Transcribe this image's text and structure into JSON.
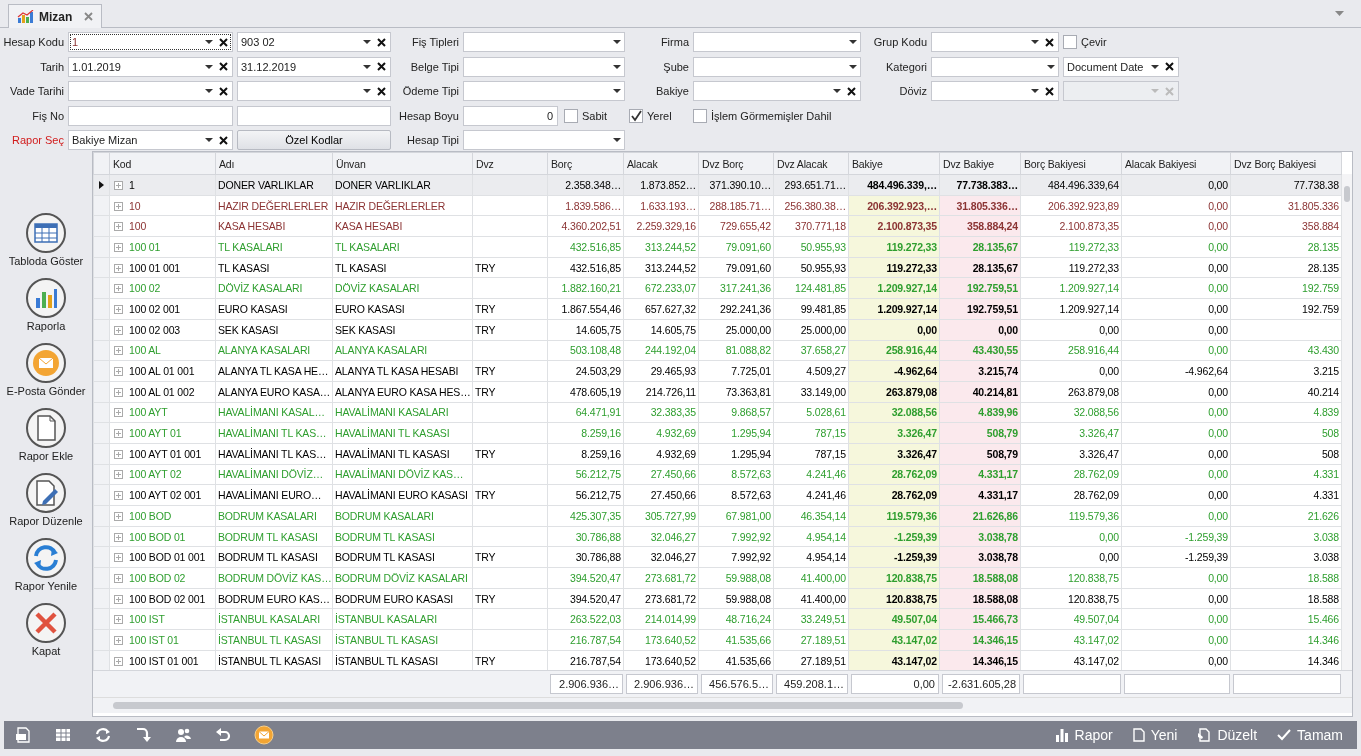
{
  "tab": {
    "title": "Mizan",
    "selected": true
  },
  "filters": [
    [
      {
        "kind": "label",
        "text": "Hesap Kodu"
      },
      {
        "kind": "combo",
        "value": "1",
        "clear": true,
        "focused": true
      },
      {
        "kind": "combo",
        "value": "903 02",
        "clear": true
      },
      {
        "kind": "label",
        "text": "Fiş Tipleri"
      },
      {
        "kind": "combo",
        "clear": false
      },
      {
        "kind": "label",
        "text": "Firma"
      },
      {
        "kind": "combo",
        "clear": false
      },
      {
        "kind": "label",
        "text": "Grup Kodu"
      },
      {
        "kind": "combo",
        "clear": true
      },
      {
        "kind": "checkbox",
        "text": "Çevir",
        "checked": false
      }
    ],
    [
      {
        "kind": "label",
        "text": "Tarih"
      },
      {
        "kind": "combo",
        "value": "1.01.2019",
        "clear": true
      },
      {
        "kind": "combo",
        "value": "31.12.2019",
        "clear": true
      },
      {
        "kind": "label",
        "text": "Belge Tipi"
      },
      {
        "kind": "combo",
        "clear": false
      },
      {
        "kind": "label",
        "text": "Şube"
      },
      {
        "kind": "combo",
        "clear": false
      },
      {
        "kind": "label",
        "text": "Kategori"
      },
      {
        "kind": "combo",
        "clear": false
      },
      {
        "kind": "combo",
        "value": "Document Date",
        "clear": true
      }
    ],
    [
      {
        "kind": "label",
        "text": "Vade Tarihi"
      },
      {
        "kind": "combo",
        "clear": true
      },
      {
        "kind": "combo",
        "clear": true
      },
      {
        "kind": "label",
        "text": "Ödeme Tipi"
      },
      {
        "kind": "combo",
        "clear": false
      },
      {
        "kind": "label",
        "text": "Bakiye"
      },
      {
        "kind": "combo",
        "clear": true
      },
      {
        "kind": "label",
        "text": "Döviz"
      },
      {
        "kind": "combo",
        "clear": true
      },
      {
        "kind": "combo",
        "clear": true,
        "disabled": true
      }
    ],
    [
      {
        "kind": "label",
        "text": "Fiş No"
      },
      {
        "kind": "text"
      },
      {
        "kind": "text"
      },
      {
        "kind": "label",
        "text": "Hesap Boyu"
      },
      {
        "kind": "number",
        "value": "0",
        "checkbox": {
          "text": "Sabit",
          "checked": false
        }
      },
      {
        "kind": "checkbox",
        "text": "Yerel",
        "checked": true
      },
      {
        "kind": "checkbox",
        "text": "İşlem Görmemişler Dahil",
        "checked": false
      }
    ],
    [
      {
        "kind": "label",
        "text": "Rapor Seç",
        "emphasis": true
      },
      {
        "kind": "combo",
        "value": "Bakiye Mizan",
        "clear": true
      },
      {
        "kind": "button",
        "text": "Özel Kodlar"
      },
      {
        "kind": "label",
        "text": "Hesap Tipi"
      },
      {
        "kind": "combo",
        "clear": false
      }
    ]
  ],
  "sidebar": [
    "Tabloda Göster",
    "Raporla",
    "E-Posta Gönder",
    "Rapor Ekle",
    "Rapor Düzenle",
    "Rapor Yenile",
    "Kapat"
  ],
  "table": {
    "columns": [
      "Kod",
      "Adı",
      "Ünvan",
      "Dvz",
      "Borç",
      "Alacak",
      "Dvz Borç",
      "Dvz Alacak",
      "Bakiye",
      "Dvz Bakiye",
      "Borç Bakiyesi",
      "Alacak Bakiyesi",
      "Dvz Borç Bakiyesi"
    ],
    "rows": [
      {
        "selected": true,
        "color": "#000000",
        "cells": [
          "1",
          "DONER VARLIKLAR",
          "DONER VARLIKLAR",
          null,
          "2.358.348…",
          "1.873.852…",
          "371.390.10…",
          "293.651.71…",
          "484.496.339,…",
          "77.738.383…",
          "484.496.339,64",
          "0,00",
          "77.738.38"
        ]
      },
      {
        "selected": false,
        "color": "#8b3333",
        "cells": [
          "10",
          "HAZIR DEĞERLERLER",
          "HAZIR DEĞERLERLER",
          null,
          "1.839.586…",
          "1.633.193…",
          "288.185.71…",
          "256.380.38…",
          "206.392.923,…",
          "31.805.336…",
          "206.392.923,89",
          "0,00",
          "31.805.336"
        ]
      },
      {
        "selected": false,
        "color": "#8b3333",
        "cells": [
          "100",
          "KASA HESABI",
          "KASA HESABI",
          null,
          "4.360.202,51",
          "2.259.329,16",
          "729.655,42",
          "370.771,18",
          "2.100.873,35",
          "358.884,24",
          "2.100.873,35",
          "0,00",
          "358.884"
        ]
      },
      {
        "selected": false,
        "color": "#2e9e2e",
        "cells": [
          "100 01",
          "TL KASALARI",
          "TL KASALARI",
          null,
          "432.516,85",
          "313.244,52",
          "79.091,60",
          "50.955,93",
          "119.272,33",
          "28.135,67",
          "119.272,33",
          "0,00",
          "28.135"
        ]
      },
      {
        "selected": false,
        "color": "#000000",
        "cells": [
          "100 01 001",
          "TL KASASI",
          "TL KASASI",
          "TRY",
          "432.516,85",
          "313.244,52",
          "79.091,60",
          "50.955,93",
          "119.272,33",
          "28.135,67",
          "119.272,33",
          "0,00",
          "28.135"
        ]
      },
      {
        "selected": false,
        "color": "#2e9e2e",
        "cells": [
          "100 02",
          "DÖVİZ KASALARI",
          "DÖVİZ KASALARI",
          null,
          "1.882.160,21",
          "672.233,07",
          "317.241,36",
          "124.481,85",
          "1.209.927,14",
          "192.759,51",
          "1.209.927,14",
          "0,00",
          "192.759"
        ]
      },
      {
        "selected": false,
        "color": "#000000",
        "cells": [
          "100 02 001",
          "EURO KASASI",
          "EURO KASASI",
          "TRY",
          "1.867.554,46",
          "657.627,32",
          "292.241,36",
          "99.481,85",
          "1.209.927,14",
          "192.759,51",
          "1.209.927,14",
          "0,00",
          "192.759"
        ]
      },
      {
        "selected": false,
        "color": "#000000",
        "cells": [
          "100 02 003",
          "SEK KASASI",
          "SEK KASASI",
          "TRY",
          "14.605,75",
          "14.605,75",
          "25.000,00",
          "25.000,00",
          "0,00",
          "0,00",
          "0,00",
          "0,00",
          null
        ]
      },
      {
        "selected": false,
        "color": "#2e9e2e",
        "cells": [
          "100 AL",
          "ALANYA KASALARI",
          "ALANYA KASALARI",
          null,
          "503.108,48",
          "244.192,04",
          "81.088,82",
          "37.658,27",
          "258.916,44",
          "43.430,55",
          "258.916,44",
          "0,00",
          "43.430"
        ]
      },
      {
        "selected": false,
        "color": "#000000",
        "cells": [
          "100 AL 01 001",
          "ALANYA TL KASA HE…",
          "ALANYA TL KASA HESABI",
          "TRY",
          "24.503,29",
          "29.465,93",
          "7.725,01",
          "4.509,27",
          "-4.962,64",
          "3.215,74",
          "0,00",
          "-4.962,64",
          "3.215"
        ]
      },
      {
        "selected": false,
        "color": "#000000",
        "cells": [
          "100 AL 01 002",
          "ALANYA EURO KASA…",
          "ALANYA EURO KASA HES…",
          "TRY",
          "478.605,19",
          "214.726,11",
          "73.363,81",
          "33.149,00",
          "263.879,08",
          "40.214,81",
          "263.879,08",
          "0,00",
          "40.214"
        ]
      },
      {
        "selected": false,
        "color": "#2e9e2e",
        "cells": [
          "100 AYT",
          "HAVALİMANI KASAL…",
          "HAVALİMANI KASALARI",
          null,
          "64.471,91",
          "32.383,35",
          "9.868,57",
          "5.028,61",
          "32.088,56",
          "4.839,96",
          "32.088,56",
          "0,00",
          "4.839"
        ]
      },
      {
        "selected": false,
        "color": "#2e9e2e",
        "cells": [
          "100 AYT 01",
          "HAVALİMANI TL KAS…",
          "HAVALİMANI TL KASASI",
          null,
          "8.259,16",
          "4.932,69",
          "1.295,94",
          "787,15",
          "3.326,47",
          "508,79",
          "3.326,47",
          "0,00",
          "508"
        ]
      },
      {
        "selected": false,
        "color": "#000000",
        "cells": [
          "100 AYT 01 001",
          "HAVALİMANI TL KAS…",
          "HAVALİMANI TL KASASI",
          "TRY",
          "8.259,16",
          "4.932,69",
          "1.295,94",
          "787,15",
          "3.326,47",
          "508,79",
          "3.326,47",
          "0,00",
          "508"
        ]
      },
      {
        "selected": false,
        "color": "#2e9e2e",
        "cells": [
          "100 AYT 02",
          "HAVALİMANI DÖVİZ…",
          "HAVALİMANI DÖVİZ KAS…",
          null,
          "56.212,75",
          "27.450,66",
          "8.572,63",
          "4.241,46",
          "28.762,09",
          "4.331,17",
          "28.762,09",
          "0,00",
          "4.331"
        ]
      },
      {
        "selected": false,
        "color": "#000000",
        "cells": [
          "100 AYT 02 001",
          "HAVALİMANI EURO…",
          "HAVALİMANI EURO KASASI",
          "TRY",
          "56.212,75",
          "27.450,66",
          "8.572,63",
          "4.241,46",
          "28.762,09",
          "4.331,17",
          "28.762,09",
          "0,00",
          "4.331"
        ]
      },
      {
        "selected": false,
        "color": "#2e9e2e",
        "cells": [
          "100 BOD",
          "BODRUM KASALARI",
          "BODRUM KASALARI",
          null,
          "425.307,35",
          "305.727,99",
          "67.981,00",
          "46.354,14",
          "119.579,36",
          "21.626,86",
          "119.579,36",
          "0,00",
          "21.626"
        ]
      },
      {
        "selected": false,
        "color": "#2e9e2e",
        "cells": [
          "100 BOD 01",
          "BODRUM TL KASASI",
          "BODRUM TL KASASI",
          null,
          "30.786,88",
          "32.046,27",
          "7.992,92",
          "4.954,14",
          "-1.259,39",
          "3.038,78",
          "0,00",
          "-1.259,39",
          "3.038"
        ]
      },
      {
        "selected": false,
        "color": "#000000",
        "cells": [
          "100 BOD 01 001",
          "BODRUM TL KASASI",
          "BODRUM TL KASASI",
          "TRY",
          "30.786,88",
          "32.046,27",
          "7.992,92",
          "4.954,14",
          "-1.259,39",
          "3.038,78",
          "0,00",
          "-1.259,39",
          "3.038"
        ]
      },
      {
        "selected": false,
        "color": "#2e9e2e",
        "cells": [
          "100 BOD 02",
          "BODRUM DÖVİZ KAS…",
          "BODRUM DÖVİZ KASALARI",
          null,
          "394.520,47",
          "273.681,72",
          "59.988,08",
          "41.400,00",
          "120.838,75",
          "18.588,08",
          "120.838,75",
          "0,00",
          "18.588"
        ]
      },
      {
        "selected": false,
        "color": "#000000",
        "cells": [
          "100 BOD 02 001",
          "BODRUM EURO KAS…",
          "BODRUM EURO KASASI",
          "TRY",
          "394.520,47",
          "273.681,72",
          "59.988,08",
          "41.400,00",
          "120.838,75",
          "18.588,08",
          "120.838,75",
          "0,00",
          "18.588"
        ]
      },
      {
        "selected": false,
        "color": "#2e9e2e",
        "cells": [
          "100 IST",
          "İSTANBUL KASALARI",
          "İSTANBUL KASALARI",
          null,
          "263.522,03",
          "214.014,99",
          "48.716,24",
          "33.249,51",
          "49.507,04",
          "15.466,73",
          "49.507,04",
          "0,00",
          "15.466"
        ]
      },
      {
        "selected": false,
        "color": "#2e9e2e",
        "cells": [
          "100 IST 01",
          "İSTANBUL TL KASASI",
          "İSTANBUL TL KASASI",
          null,
          "216.787,54",
          "173.640,52",
          "41.535,66",
          "27.189,51",
          "43.147,02",
          "14.346,15",
          "43.147,02",
          "0,00",
          "14.346"
        ]
      },
      {
        "selected": false,
        "color": "#000000",
        "cells": [
          "100 IST 01 001",
          "İSTANBUL TL KASASI",
          "İSTANBUL TL KASASI",
          "TRY",
          "216.787,54",
          "173.640,52",
          "41.535,66",
          "27.189,51",
          "43.147,02",
          "14.346,15",
          "43.147,02",
          "0,00",
          "14.346"
        ]
      }
    ],
    "totals": [
      "2.906.936…",
      "2.906.936…",
      "456.576.5…",
      "459.208.1…",
      "0,00",
      "-2.631.605,28"
    ]
  },
  "toolbar": {
    "actions": [
      "Rapor",
      "Yeni",
      "Düzelt",
      "Tamam"
    ]
  }
}
